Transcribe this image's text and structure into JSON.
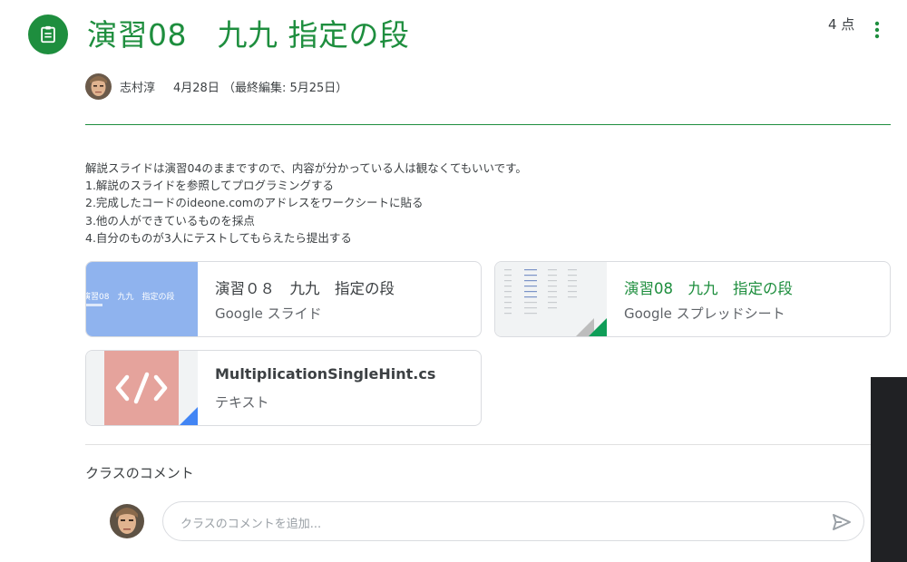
{
  "assignment": {
    "title": "演習08　九九 指定の段",
    "points": "4 点",
    "author": "志村淳",
    "date": "4月28日 （最終編集: 5月25日）",
    "icon": "assignment-icon"
  },
  "description": "解説スライドは演習04のままですので、内容が分かっている人は観なくてもいいです。\n1.解説のスライドを参照してプログラミングする\n2.完成したコードのideone.comのアドレスをワークシートに貼る\n3.他の人ができているものを採点\n4.自分のものが3人にテストしてもらえたら提出する",
  "attachments": [
    {
      "name": "演習０８　九九　指定の段",
      "kind": "Google スライド",
      "thumb_text": "演習08　九九　指定の段"
    },
    {
      "name": "演習08　九九　指定の段",
      "kind": "Google スプレッドシート"
    },
    {
      "name": "MultiplicationSingleHint.cs",
      "kind": "テキスト",
      "icon": "code-file-icon"
    }
  ],
  "comments": {
    "heading": "クラスのコメント",
    "placeholder": "クラスのコメントを追加...",
    "send_icon": "send-icon"
  },
  "colors": {
    "accent": "#1e8e3e",
    "slides_thumb": "#8fb3ee",
    "slides_fold": "#f4b400",
    "sheets_fold": "#0f9d58",
    "code_thumb": "#e5a39c",
    "code_fold": "#4285f4"
  }
}
